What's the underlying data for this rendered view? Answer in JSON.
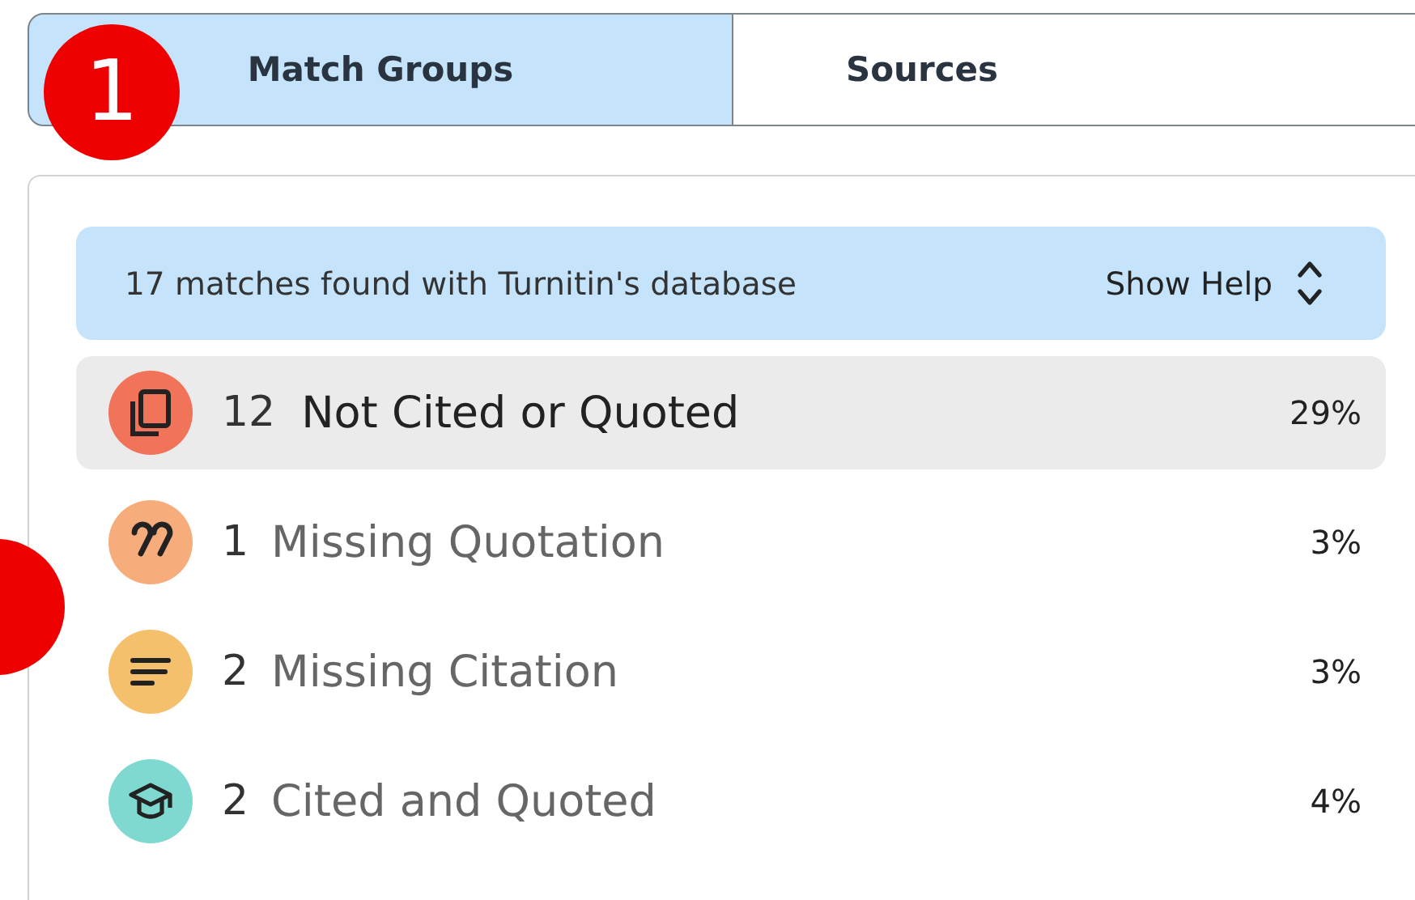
{
  "annotations": [
    {
      "kind": "numbered",
      "label": "1"
    },
    {
      "kind": "blank"
    }
  ],
  "tabs": [
    {
      "label": "Match Groups",
      "selected": true
    },
    {
      "label": "Sources",
      "selected": false
    }
  ],
  "banner": {
    "text": "17 matches found with Turnitin's database",
    "help": "Show Help"
  },
  "groups": [
    {
      "kind": "copy",
      "color": "#f0735a",
      "count": "12",
      "label": "Not Cited or Quoted",
      "percent": "29%",
      "selected": true
    },
    {
      "kind": "quote",
      "color": "#f7ac7b",
      "count": "1",
      "label": "Missing Quotation",
      "percent": "3%",
      "selected": false
    },
    {
      "kind": "lines",
      "color": "#f5c06b",
      "count": "2",
      "label": "Missing Citation",
      "percent": "3%",
      "selected": false
    },
    {
      "kind": "cap",
      "color": "#7fd9d0",
      "count": "2",
      "label": "Cited and Quoted",
      "percent": "4%",
      "selected": false
    }
  ]
}
